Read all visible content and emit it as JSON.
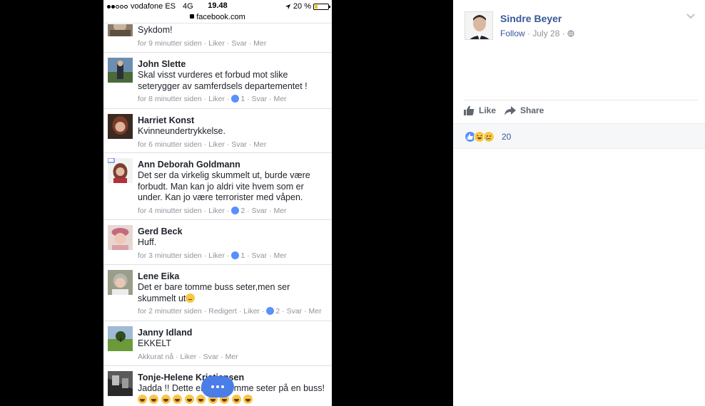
{
  "status_bar": {
    "carrier": "vodafone ES",
    "network": "4G",
    "time": "19.48",
    "battery": "20 %"
  },
  "url_bar": {
    "url": "facebook.com"
  },
  "comments": [
    {
      "name": "",
      "text": "Sykdom!",
      "time": "for 9 minutter siden",
      "like": "Liker",
      "reply": "Svar",
      "more": "Mer",
      "reactions": ""
    },
    {
      "name": "John Slette",
      "text": "Skal visst vurderes et forbud mot slike seterygger av samferdsels departementet !",
      "time": "for 8 minutter siden",
      "like": "Liker",
      "reply": "Svar",
      "more": "Mer",
      "reactions": "1"
    },
    {
      "name": "Harriet Konst",
      "text": "Kvinneundertrykkelse.",
      "time": "for 6 minutter siden",
      "like": "Liker",
      "reply": "Svar",
      "more": "Mer",
      "reactions": ""
    },
    {
      "name": "Ann Deborah Goldmann",
      "text": "Det ser da virkelig skummelt ut, burde være forbudt. Man kan jo aldri vite hvem som er under. Kan jo være terrorister med våpen.",
      "time": "for 4 minutter siden",
      "like": "Liker",
      "reply": "Svar",
      "more": "Mer",
      "reactions": "2"
    },
    {
      "name": "Gerd Beck",
      "text": "Huff.",
      "time": "for 3 minutter siden",
      "like": "Liker",
      "reply": "Svar",
      "more": "Mer",
      "reactions": "1"
    },
    {
      "name": "Lene Eika",
      "text": "Det er bare tomme buss seter,men ser skummelt ut",
      "time": "for 2 minutter siden",
      "edited": "Redigert",
      "like": "Liker",
      "reply": "Svar",
      "more": "Mer",
      "reactions": "2"
    },
    {
      "name": "Janny Idland",
      "text": "EKKELT",
      "time": "Akkurat nå",
      "like": "Liker",
      "reply": "Svar",
      "more": "Mer",
      "reactions": ""
    },
    {
      "name": "Tonje-Helene Kristiansen",
      "text": "Jadda !! Dette er bare tomme seter på en buss!",
      "time": "",
      "like": "",
      "reply": "",
      "more": "",
      "reactions": ""
    }
  ],
  "post": {
    "author": "Sindre Beyer",
    "follow": "Follow",
    "date": "July 28",
    "like_label": "Like",
    "share_label": "Share",
    "reaction_count": "20"
  },
  "colors": {
    "link": "#365899",
    "meta": "#90949c",
    "like_blue": "#5890ff",
    "fab": "#4b7de8"
  },
  "icons": [
    "lock-icon",
    "location-arrow-icon",
    "battery-icon",
    "globe-icon",
    "chevron-down-icon",
    "thumbs-up-icon",
    "share-arrow-icon",
    "like-reaction-icon",
    "haha-reaction-icon",
    "sad-reaction-icon",
    "more-dots-icon"
  ]
}
